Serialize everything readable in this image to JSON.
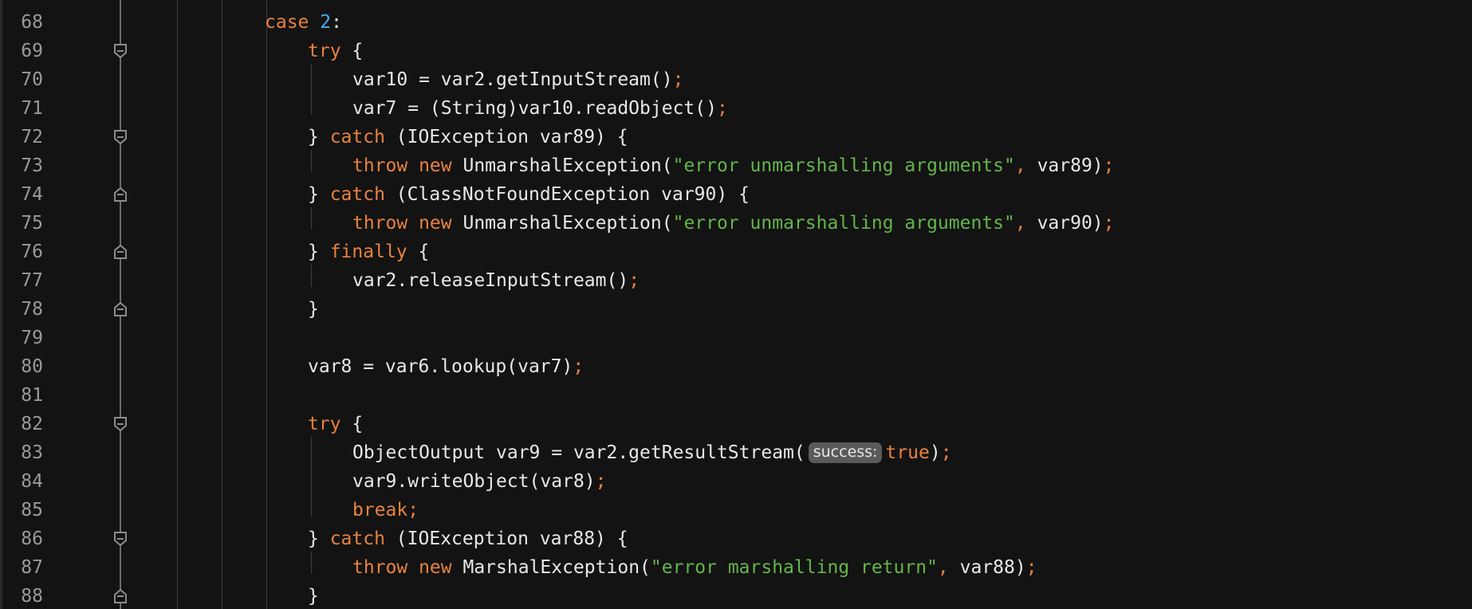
{
  "editor": {
    "colors": {
      "background": "#131313",
      "keyword": "#e8823e",
      "number": "#3fb4f0",
      "string": "#63b54a",
      "text": "#e8e8e8",
      "line_number": "#9a9a9a"
    },
    "lines": [
      {
        "number": "68",
        "tokens": [
          {
            "t": "kw",
            "v": "case "
          },
          {
            "t": "num",
            "v": "2"
          },
          {
            "t": "plain",
            "v": ":"
          }
        ]
      },
      {
        "number": "69",
        "tokens": [
          {
            "t": "kw",
            "v": "try"
          },
          {
            "t": "plain",
            "v": " {"
          }
        ]
      },
      {
        "number": "70",
        "tokens": [
          {
            "t": "plain",
            "v": "var10 = var2.getInputStream()"
          },
          {
            "t": "punc",
            "v": ";"
          }
        ]
      },
      {
        "number": "71",
        "tokens": [
          {
            "t": "plain",
            "v": "var7 = (String)var10.readObject()"
          },
          {
            "t": "punc",
            "v": ";"
          }
        ]
      },
      {
        "number": "72",
        "tokens": [
          {
            "t": "plain",
            "v": "} "
          },
          {
            "t": "kw",
            "v": "catch"
          },
          {
            "t": "plain",
            "v": " (IOException var89) {"
          }
        ]
      },
      {
        "number": "73",
        "tokens": [
          {
            "t": "kw",
            "v": "throw new "
          },
          {
            "t": "plain",
            "v": "UnmarshalException("
          },
          {
            "t": "str",
            "v": "\"error unmarshalling arguments\""
          },
          {
            "t": "punc",
            "v": ","
          },
          {
            "t": "plain",
            "v": " var89)"
          },
          {
            "t": "punc",
            "v": ";"
          }
        ]
      },
      {
        "number": "74",
        "tokens": [
          {
            "t": "plain",
            "v": "} "
          },
          {
            "t": "kw",
            "v": "catch"
          },
          {
            "t": "plain",
            "v": " (ClassNotFoundException var90) {"
          }
        ]
      },
      {
        "number": "75",
        "tokens": [
          {
            "t": "kw",
            "v": "throw new "
          },
          {
            "t": "plain",
            "v": "UnmarshalException("
          },
          {
            "t": "str",
            "v": "\"error unmarshalling arguments\""
          },
          {
            "t": "punc",
            "v": ","
          },
          {
            "t": "plain",
            "v": " var90)"
          },
          {
            "t": "punc",
            "v": ";"
          }
        ]
      },
      {
        "number": "76",
        "tokens": [
          {
            "t": "plain",
            "v": "} "
          },
          {
            "t": "kw",
            "v": "finally"
          },
          {
            "t": "plain",
            "v": " {"
          }
        ]
      },
      {
        "number": "77",
        "tokens": [
          {
            "t": "plain",
            "v": "var2.releaseInputStream()"
          },
          {
            "t": "punc",
            "v": ";"
          }
        ]
      },
      {
        "number": "78",
        "tokens": [
          {
            "t": "plain",
            "v": "}"
          }
        ]
      },
      {
        "number": "79",
        "tokens": []
      },
      {
        "number": "80",
        "tokens": [
          {
            "t": "plain",
            "v": "var8 = var6.lookup(var7)"
          },
          {
            "t": "punc",
            "v": ";"
          }
        ]
      },
      {
        "number": "81",
        "tokens": []
      },
      {
        "number": "82",
        "tokens": [
          {
            "t": "kw",
            "v": "try"
          },
          {
            "t": "plain",
            "v": " {"
          }
        ]
      },
      {
        "number": "83",
        "tokens": [
          {
            "t": "plain",
            "v": "ObjectOutput var9 = var2.getResultStream("
          },
          {
            "t": "hint",
            "v": "success:"
          },
          {
            "t": "kw",
            "v": "true"
          },
          {
            "t": "plain",
            "v": ")"
          },
          {
            "t": "punc",
            "v": ";"
          }
        ]
      },
      {
        "number": "84",
        "tokens": [
          {
            "t": "plain",
            "v": "var9.writeObject(var8)"
          },
          {
            "t": "punc",
            "v": ";"
          }
        ]
      },
      {
        "number": "85",
        "tokens": [
          {
            "t": "kw",
            "v": "break"
          },
          {
            "t": "punc",
            "v": ";"
          }
        ]
      },
      {
        "number": "86",
        "tokens": [
          {
            "t": "plain",
            "v": "} "
          },
          {
            "t": "kw",
            "v": "catch"
          },
          {
            "t": "plain",
            "v": " (IOException var88) {"
          }
        ]
      },
      {
        "number": "87",
        "tokens": [
          {
            "t": "kw",
            "v": "throw new "
          },
          {
            "t": "plain",
            "v": "MarshalException("
          },
          {
            "t": "str",
            "v": "\"error marshalling return\""
          },
          {
            "t": "punc",
            "v": ","
          },
          {
            "t": "plain",
            "v": " var88)"
          },
          {
            "t": "punc",
            "v": ";"
          }
        ]
      },
      {
        "number": "88",
        "tokens": [
          {
            "t": "plain",
            "v": "}"
          }
        ]
      }
    ]
  }
}
